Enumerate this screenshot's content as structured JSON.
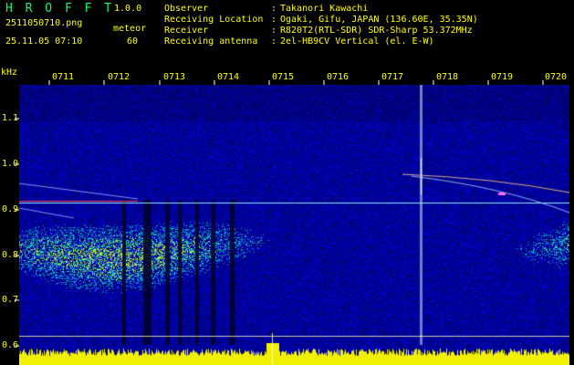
{
  "header": {
    "app_name": "H R O F F T",
    "version": "1.0.0",
    "filename": "2511050710.png",
    "datetime": "25.11.05 07:10",
    "meteor_label": "meteor",
    "meteor_count": "60",
    "info": [
      {
        "label": "Observer",
        "sep": ":",
        "value": "Takanori Kawachi"
      },
      {
        "label": "Receiving Location",
        "sep": ":",
        "value": "Ogaki, Gifu, JAPAN (136.60E, 35.35N)"
      },
      {
        "label": "Receiver",
        "sep": ":",
        "value": "R820T2(RTL-SDR) SDR-Sharp 53.372MHz"
      },
      {
        "label": "Receiving antenna",
        "sep": ":",
        "value": "2el-HB9CV Vertical (el. E-W)"
      }
    ]
  },
  "spectrogram": {
    "y_unit": "kHz",
    "y_ticks": [
      "1.1",
      "1.0",
      "0.9",
      "0.8",
      "0.7",
      "0.6"
    ],
    "x_ticks": [
      "0711",
      "0712",
      "0713",
      "0714",
      "0715",
      "0716",
      "0717",
      "0718",
      "0719",
      "0720"
    ],
    "colors": {
      "background": "#000000",
      "label_text": "#ffff00",
      "header_text": "#00ff66",
      "tick": "#ffffff",
      "noise_base": "#0a1a9a"
    }
  }
}
